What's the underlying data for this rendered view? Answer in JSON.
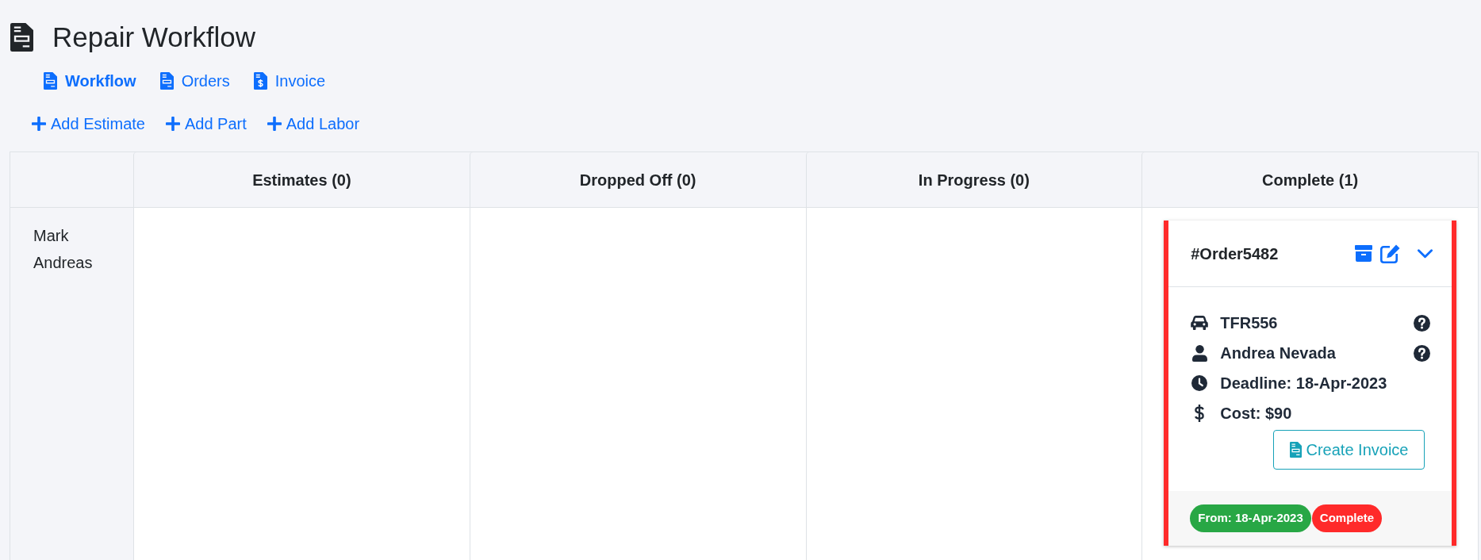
{
  "title": "Repair Workflow",
  "nav": [
    {
      "label": "Workflow",
      "kind": "document",
      "selected": true
    },
    {
      "label": "Orders",
      "kind": "document",
      "selected": false
    },
    {
      "label": "Invoice",
      "kind": "invoice",
      "selected": false
    }
  ],
  "actions": [
    "Add Estimate",
    "Add Part",
    "Add Labor"
  ],
  "board": {
    "columns": [
      "Estimates (0)",
      "Dropped Off (0)",
      "In Progress (0)",
      "Complete (1)"
    ],
    "rows": [
      {
        "name": "Mark Andreas",
        "cells": [
          {},
          {},
          {},
          {
            "cards": [
              {
                "order": "#Order5482",
                "color": "#ff2a2a",
                "expanded": true,
                "details": [
                  {
                    "kind": "vehicle",
                    "text": "TFR556",
                    "help": true
                  },
                  {
                    "kind": "customer",
                    "text": "Andrea Nevada",
                    "help": true
                  },
                  {
                    "kind": "deadline",
                    "text": "Deadline: 18-Apr-2023",
                    "help": false
                  },
                  {
                    "kind": "cost",
                    "text": "Cost: $90",
                    "help": false
                  }
                ],
                "button": "Create Invoice",
                "tags": [
                  {
                    "text": "From: 18-Apr-2023",
                    "color": "#28a745"
                  },
                  {
                    "text": "Complete",
                    "color": "#ff2a2a"
                  }
                ]
              }
            ]
          }
        ]
      }
    ]
  }
}
